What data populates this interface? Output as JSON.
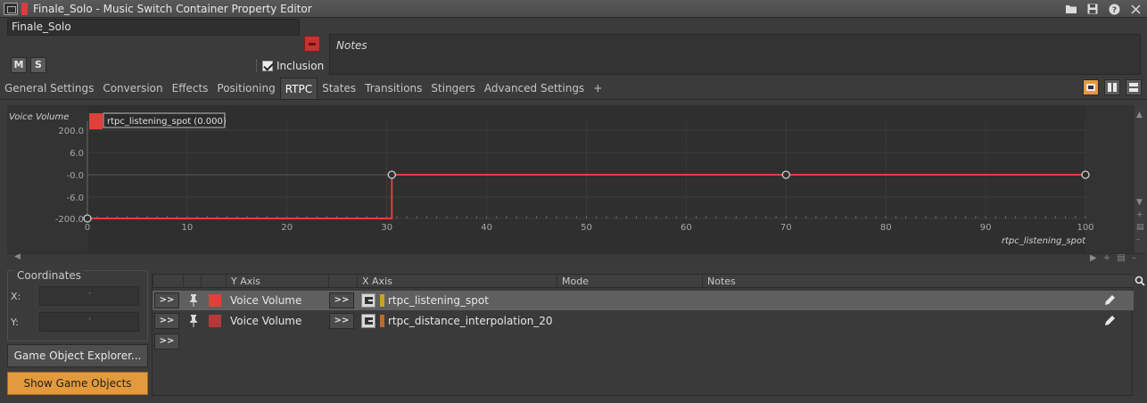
{
  "window": {
    "title": "Finale_Solo - Music Switch Container Property Editor",
    "object_color": "#d63e3e"
  },
  "object": {
    "name": "Finale_Solo",
    "mute_label": "M",
    "solo_label": "S",
    "inclusion_label": "Inclusion",
    "inclusion_checked": true,
    "notes_label": "Notes"
  },
  "tabs": [
    {
      "label": "General Settings",
      "active": false
    },
    {
      "label": "Conversion",
      "active": false
    },
    {
      "label": "Effects",
      "active": false
    },
    {
      "label": "Positioning",
      "active": false
    },
    {
      "label": "RTPC",
      "active": true
    },
    {
      "label": "States",
      "active": false
    },
    {
      "label": "Transitions",
      "active": false
    },
    {
      "label": "Stingers",
      "active": false
    },
    {
      "label": "Advanced Settings",
      "active": false
    },
    {
      "label": "+",
      "active": false
    }
  ],
  "chart_data": {
    "type": "line",
    "ylabel": "Voice Volume",
    "xlabel": "rtpc_listening_spot",
    "legend": "rtpc_listening_spot (0.000)",
    "x_ticks": [
      "0",
      "10",
      "20",
      "30",
      "40",
      "50",
      "60",
      "70",
      "80",
      "90",
      "100"
    ],
    "y_ticks": [
      "200.0",
      "6.0",
      "-0.0",
      "-6.0",
      "-200.0"
    ],
    "xlim": [
      0,
      100
    ],
    "series": [
      {
        "name": "rtpc_listening_spot",
        "color": "#e0403a",
        "points": [
          {
            "x": 0,
            "y": -200.0
          },
          {
            "x": 30.5,
            "y": -200.0
          },
          {
            "x": 30.5,
            "y": -0.0
          },
          {
            "x": 70,
            "y": -0.0
          },
          {
            "x": 100,
            "y": -0.0
          }
        ]
      }
    ]
  },
  "coordinates": {
    "title": "Coordinates",
    "x_label": "X:",
    "y_label": "Y:",
    "x_value": "",
    "y_value": ""
  },
  "buttons": {
    "game_object_explorer": "Game Object Explorer...",
    "show_game_objects": "Show Game Objects"
  },
  "table": {
    "headers": {
      "y_axis": "Y Axis",
      "x_axis": "X Axis",
      "mode": "Mode",
      "notes": "Notes"
    },
    "expand_label": ">>",
    "rows": [
      {
        "y_axis": "Voice Volume",
        "x_axis": "rtpc_listening_spot",
        "color": "#e0403a",
        "bar_color": "#c9a227",
        "selected": true
      },
      {
        "y_axis": "Voice Volume",
        "x_axis": "rtpc_distance_interpolation_20",
        "color": "#b5393a",
        "bar_color": "#c06a28",
        "selected": false
      }
    ]
  }
}
